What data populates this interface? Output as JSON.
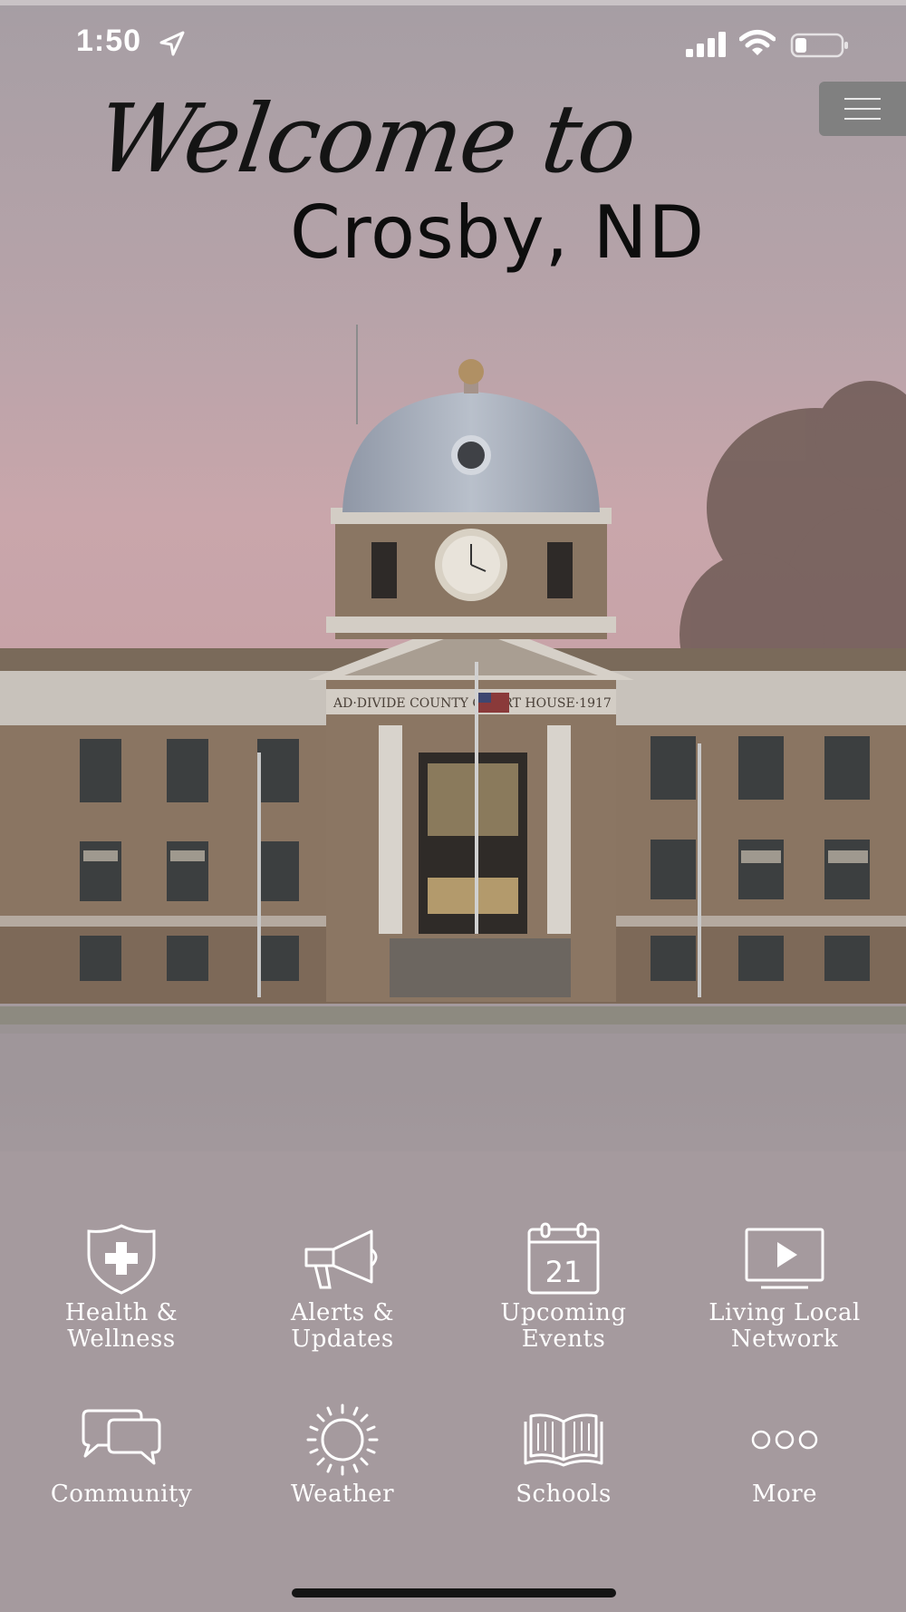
{
  "status_bar": {
    "time": "1:50",
    "icons": [
      "location-arrow-icon",
      "cellular-signal-icon",
      "wifi-icon",
      "battery-icon"
    ]
  },
  "menu": {
    "icon": "hamburger-menu-icon"
  },
  "header": {
    "welcome_line": "Welcome to",
    "place_line": "Crosby, ND"
  },
  "hero": {
    "building_inscription": "AD·DIVIDE COUNTY COURT HOUSE·1917"
  },
  "nav": [
    {
      "icon": "health-shield-cross-icon",
      "line1": "Health &",
      "line2": "Wellness"
    },
    {
      "icon": "megaphone-icon",
      "line1": "Alerts &",
      "line2": "Updates"
    },
    {
      "icon": "calendar-icon",
      "calendar_day": "21",
      "line1": "Upcoming",
      "line2": "Events"
    },
    {
      "icon": "video-play-icon",
      "line1": "Living Local",
      "line2": "Network"
    },
    {
      "icon": "chat-bubbles-icon",
      "line1": "Community",
      "line2": ""
    },
    {
      "icon": "sun-icon",
      "line1": "Weather",
      "line2": ""
    },
    {
      "icon": "open-book-icon",
      "line1": "Schools",
      "line2": ""
    },
    {
      "icon": "more-dots-icon",
      "line1": "More",
      "line2": ""
    }
  ],
  "colors": {
    "background": "#a59a9e",
    "sky_pink": "#c8a3aa",
    "menu_button": "#808080",
    "label_text": "#ffffff",
    "title_text": "#111111"
  }
}
